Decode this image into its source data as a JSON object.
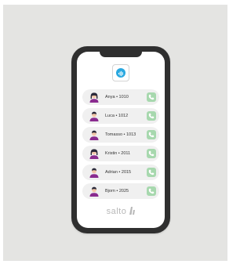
{
  "contacts": [
    {
      "label": "Anya • 1010",
      "gender": "female"
    },
    {
      "label": "Luca • 1012",
      "gender": "male"
    },
    {
      "label": "Tomasso • 1013",
      "gender": "male"
    },
    {
      "label": "Kristin • 2011",
      "gender": "female"
    },
    {
      "label": "Adrian • 2015",
      "gender": "male"
    },
    {
      "label": "Bjorn • 2025",
      "gender": "male"
    }
  ],
  "brand": {
    "name": "salto"
  },
  "colors": {
    "app_icon": "#29a8e0",
    "call_button": "#a7d8ae",
    "avatar_shirt": "#8a2b8f",
    "avatar_skin": "#f2c7a8",
    "avatar_hair": "#2b2a3a"
  },
  "icons": {
    "app": "soundwave-icon",
    "call": "phone-icon",
    "avatar": "person-avatar-icon",
    "brand": "salto-logo-mark"
  }
}
